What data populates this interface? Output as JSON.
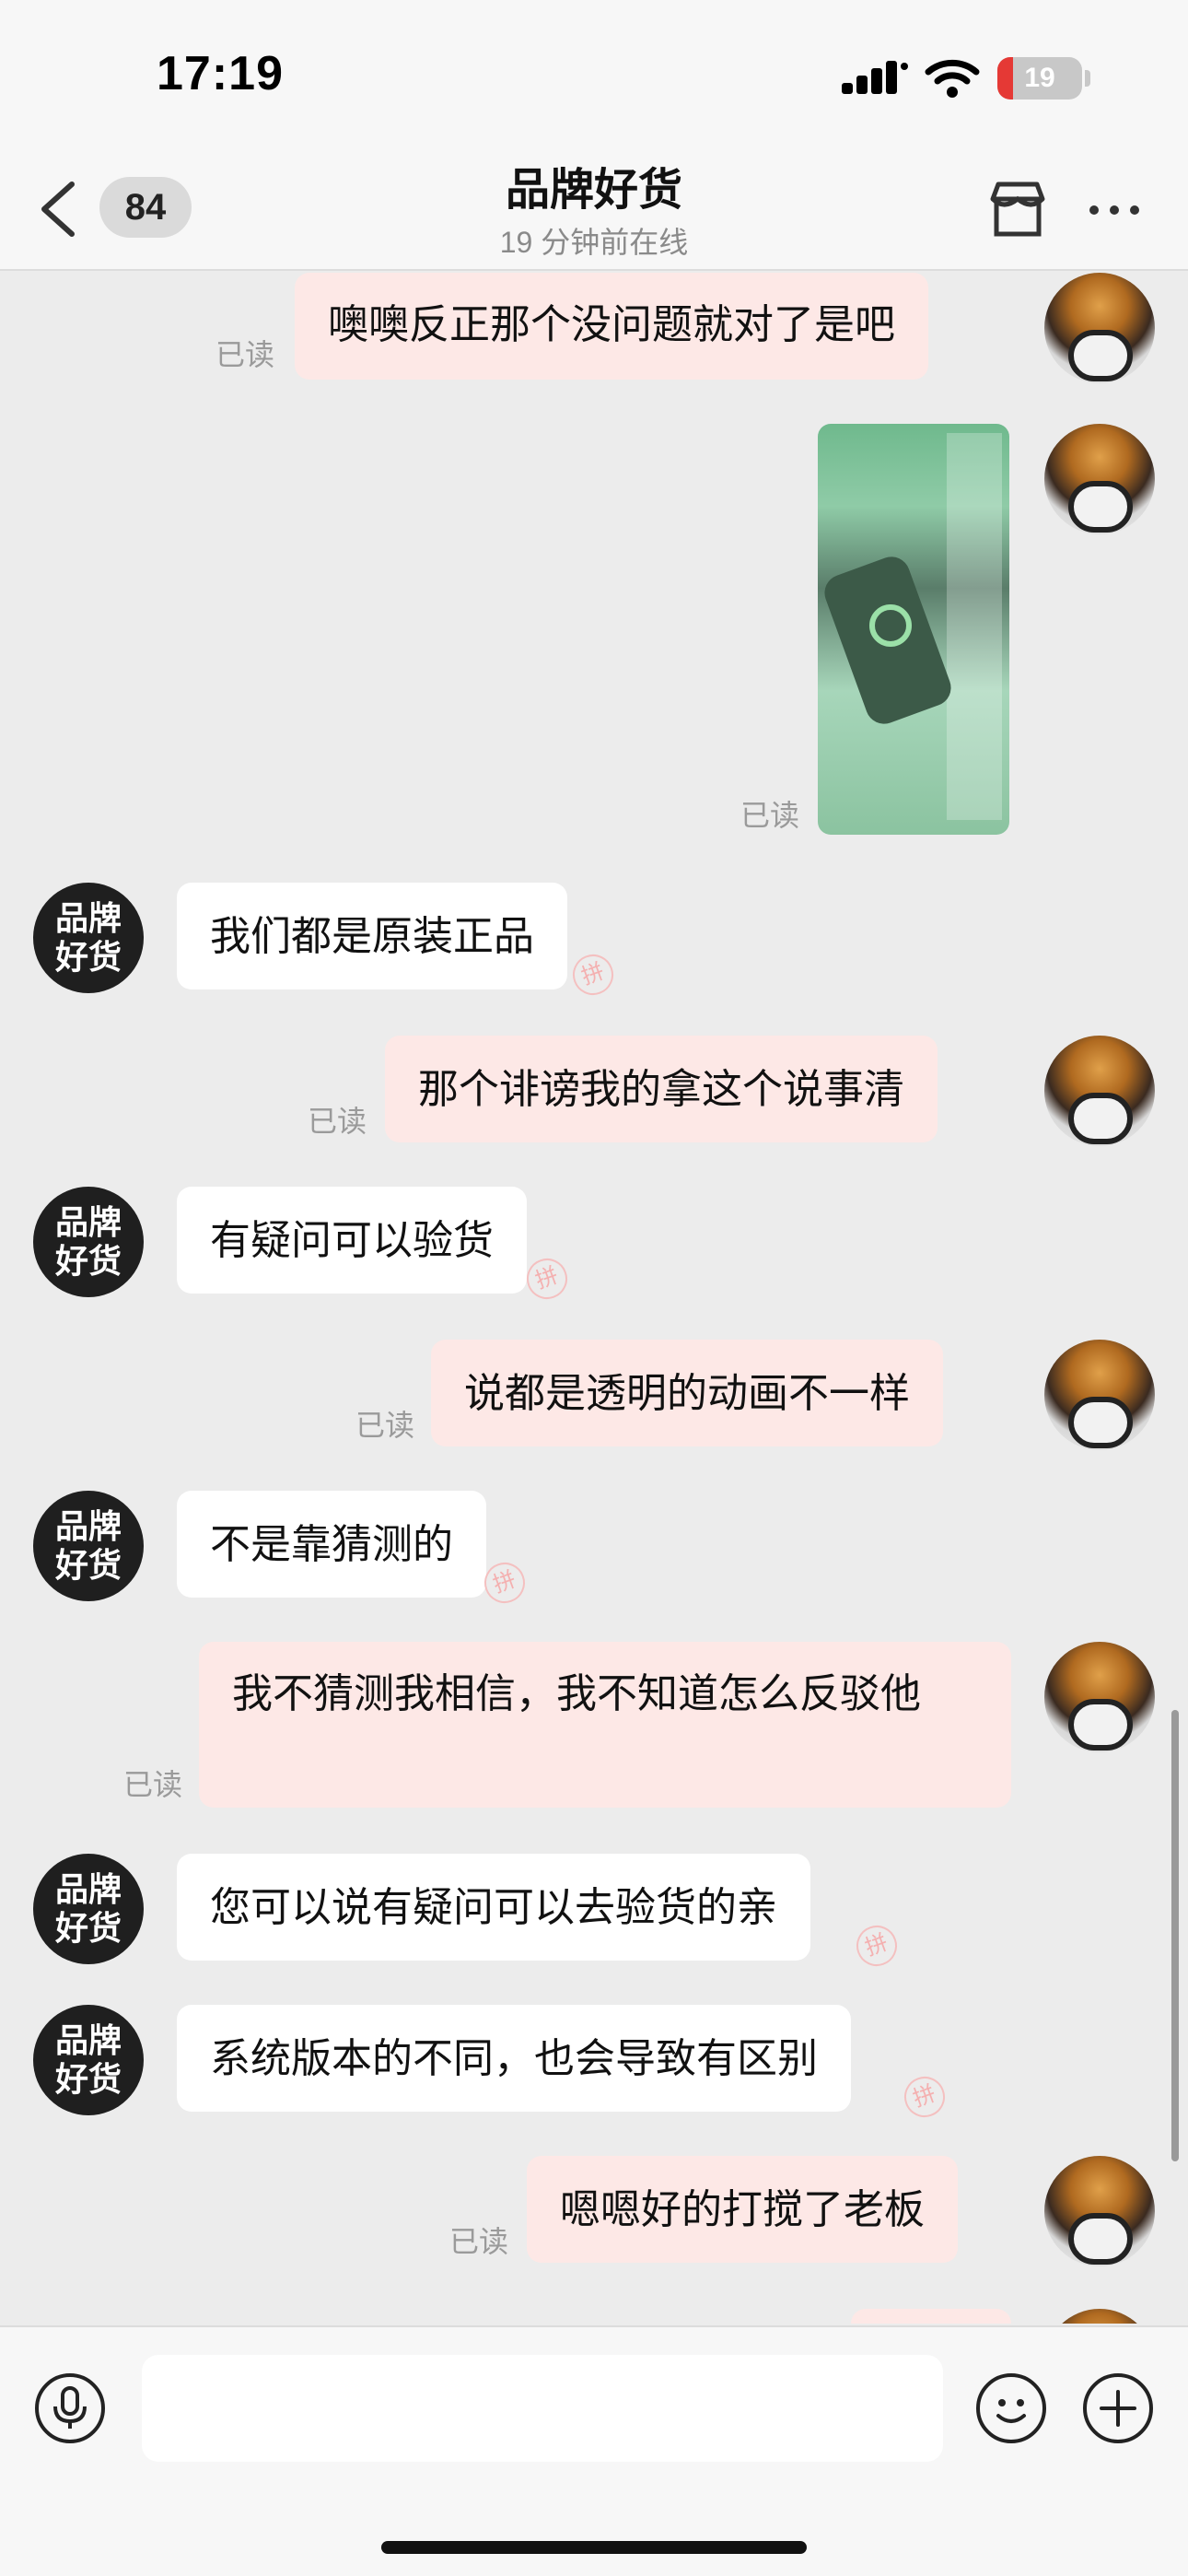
{
  "status": {
    "time": "17:19",
    "battery": "19",
    "battery_level": 0.19
  },
  "header": {
    "unread_count": "84",
    "title": "品牌好货",
    "subtitle": "19 分钟前在线"
  },
  "chat": {
    "read_label": "已读",
    "shop_avatar_text": "品牌好货",
    "messages": [
      {
        "side": "sent",
        "text": "噢噢反正那个没问题就对了是吧",
        "read": true
      },
      {
        "side": "sent",
        "type": "image",
        "read": true
      },
      {
        "side": "recv",
        "text": "我们都是原装正品"
      },
      {
        "side": "sent",
        "text": "那个诽谤我的拿这个说事清",
        "read": true
      },
      {
        "side": "recv",
        "text": "有疑问可以验货"
      },
      {
        "side": "sent",
        "text": "说都是透明的动画不一样",
        "read": true
      },
      {
        "side": "recv",
        "text": "不是靠猜测的"
      },
      {
        "side": "sent",
        "text": "我不猜测我相信，我不知道怎么反驳他",
        "read": true
      },
      {
        "side": "recv",
        "text": "您可以说有疑问可以去验货的亲"
      },
      {
        "side": "recv",
        "text": "系统版本的不同，也会导致有区别"
      },
      {
        "side": "sent",
        "text": "嗯嗯好的打搅了老板",
        "read": true
      }
    ]
  },
  "composer": {
    "placeholder": ""
  },
  "icons": {
    "back": "chevron-left-icon",
    "store": "store-icon",
    "more": "more-icon",
    "mic": "microphone-icon",
    "emoji": "emoji-icon",
    "plus": "plus-icon"
  },
  "colors": {
    "sent_bubble": "#fde8e6",
    "recv_bubble": "#ffffff",
    "background": "#ececec",
    "battery_low": "#e53935"
  }
}
